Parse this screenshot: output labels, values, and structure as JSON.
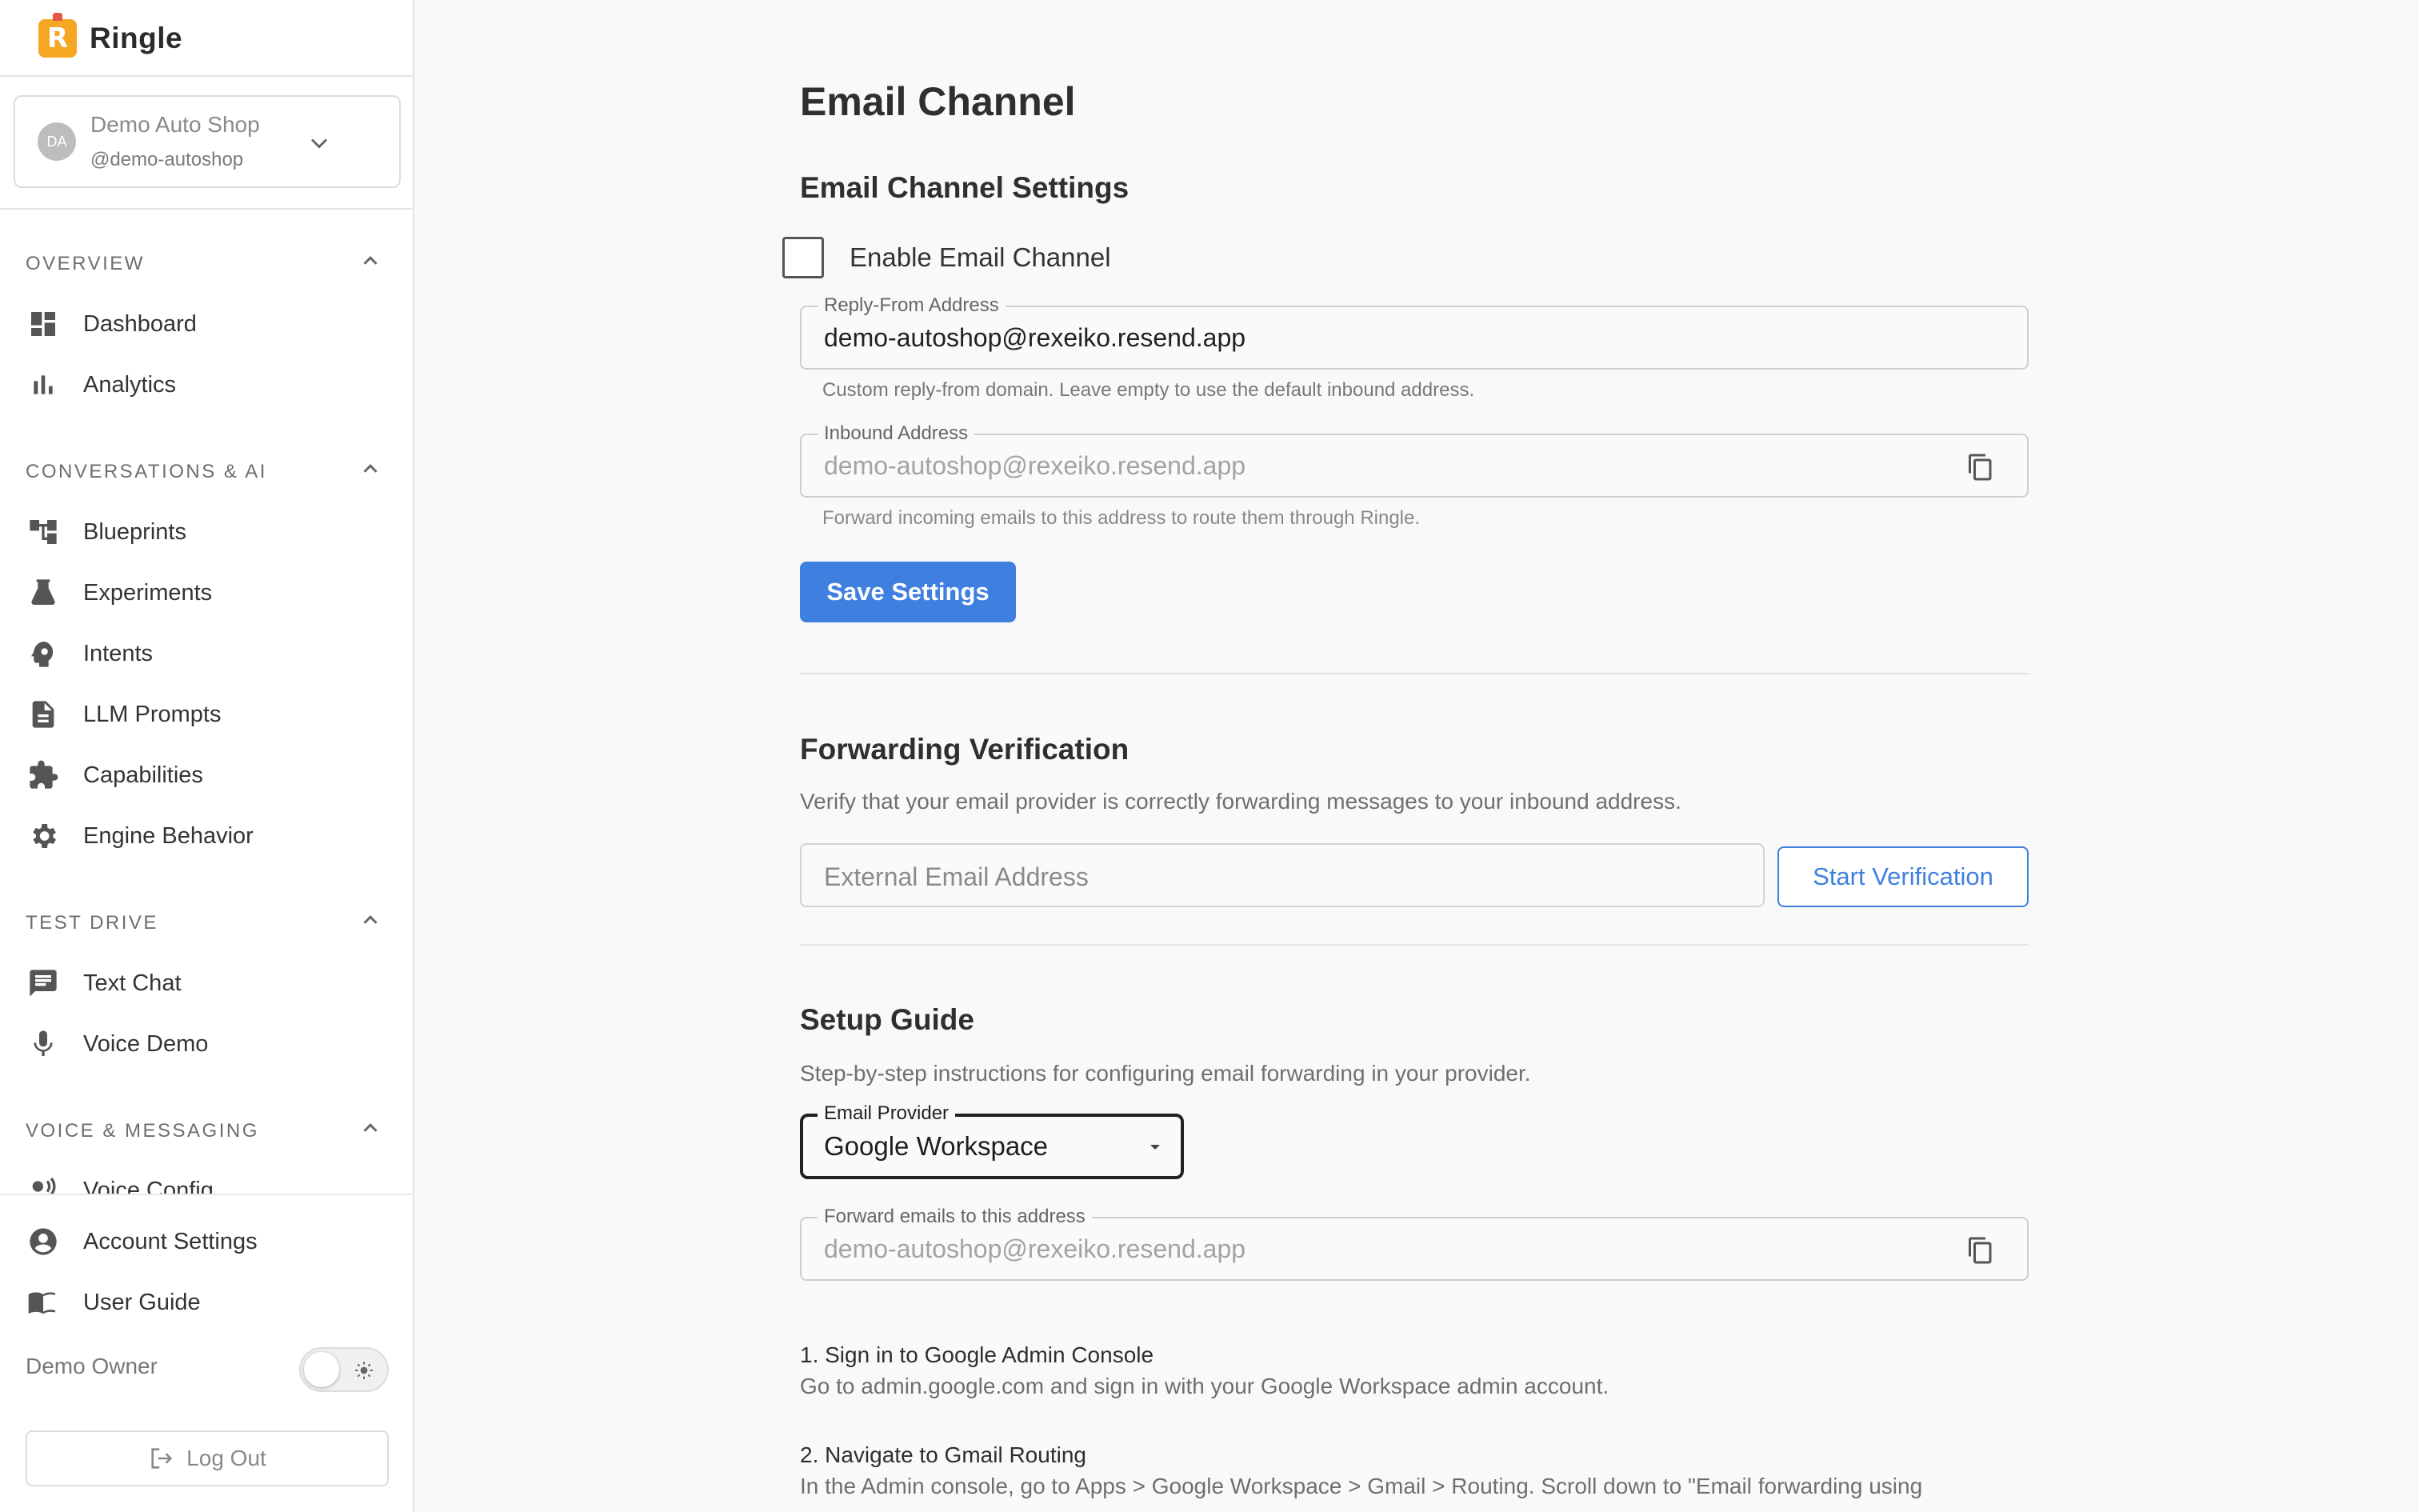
{
  "app": {
    "name": "Ringle",
    "logo_letter": "R"
  },
  "account": {
    "initials": "DA",
    "name": "Demo Auto Shop",
    "handle": "@demo-autoshop"
  },
  "sidebar": {
    "sections": [
      {
        "title": "OVERVIEW",
        "items": [
          {
            "label": "Dashboard",
            "icon": "dashboard-icon"
          },
          {
            "label": "Analytics",
            "icon": "bar-chart-icon"
          }
        ]
      },
      {
        "title": "CONVERSATIONS & AI",
        "items": [
          {
            "label": "Blueprints",
            "icon": "tree-icon"
          },
          {
            "label": "Experiments",
            "icon": "flask-icon"
          },
          {
            "label": "Intents",
            "icon": "head-gear-icon"
          },
          {
            "label": "LLM Prompts",
            "icon": "document-icon"
          },
          {
            "label": "Capabilities",
            "icon": "puzzle-icon"
          },
          {
            "label": "Engine Behavior",
            "icon": "gear-icon"
          }
        ]
      },
      {
        "title": "TEST DRIVE",
        "items": [
          {
            "label": "Text Chat",
            "icon": "chat-icon"
          },
          {
            "label": "Voice Demo",
            "icon": "microphone-icon"
          }
        ]
      },
      {
        "title": "VOICE & MESSAGING",
        "items": [
          {
            "label": "Voice Config",
            "icon": "voice-icon"
          }
        ]
      }
    ],
    "footer": {
      "account_settings": "Account Settings",
      "user_guide": "User Guide",
      "owner": "Demo Owner",
      "logout": "Log Out"
    }
  },
  "main": {
    "title": "Email Channel",
    "settings": {
      "title": "Email Channel Settings",
      "enable_label": "Enable Email Channel",
      "reply_from": {
        "label": "Reply-From Address",
        "value": "demo-autoshop@rexeiko.resend.app",
        "helper": "Custom reply-from domain. Leave empty to use the default inbound address."
      },
      "inbound": {
        "label": "Inbound Address",
        "value": "demo-autoshop@rexeiko.resend.app",
        "helper": "Forward incoming emails to this address to route them through Ringle."
      },
      "save_label": "Save Settings"
    },
    "verification": {
      "title": "Forwarding Verification",
      "description": "Verify that your email provider is correctly forwarding messages to your inbound address.",
      "input_placeholder": "External Email Address",
      "button_label": "Start Verification"
    },
    "guide": {
      "title": "Setup Guide",
      "description": "Step-by-step instructions for configuring email forwarding in your provider.",
      "provider_label": "Email Provider",
      "provider_value": "Google Workspace",
      "forward_label": "Forward emails to this address",
      "forward_value": "demo-autoshop@rexeiko.resend.app",
      "steps": [
        {
          "title": "1. Sign in to Google Admin Console",
          "body": "Go to admin.google.com and sign in with your Google Workspace admin account."
        },
        {
          "title": "2. Navigate to Gmail Routing",
          "body": "In the Admin console, go to Apps > Google Workspace > Gmail > Routing. Scroll down to \"Email forwarding using"
        }
      ]
    }
  },
  "colors": {
    "primary": "#3f7fe0",
    "logo": "#f5a623"
  }
}
